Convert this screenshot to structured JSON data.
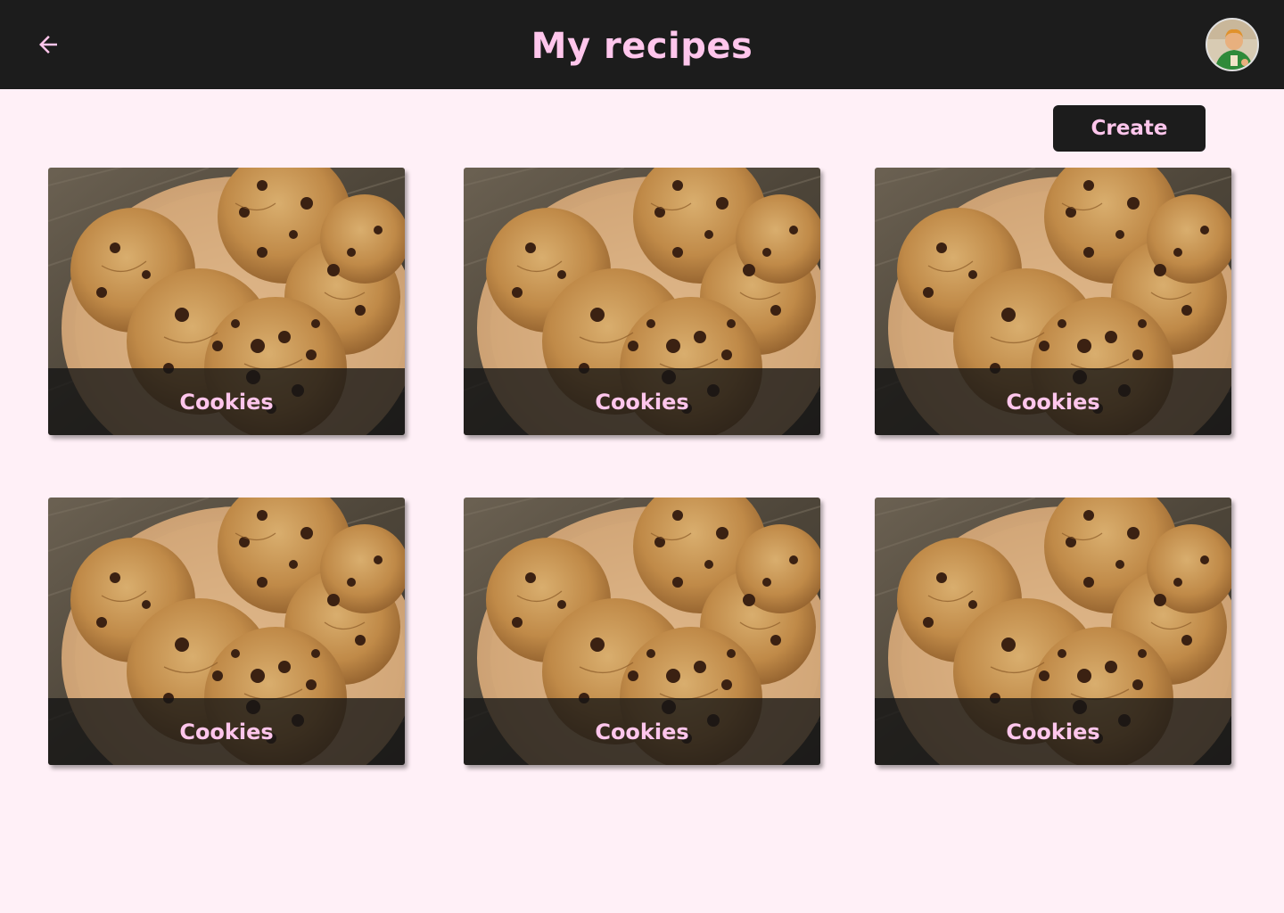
{
  "header": {
    "title": "My recipes",
    "back_icon": "arrow-left-icon",
    "avatar_icon": "user-avatar"
  },
  "toolbar": {
    "create_label": "Create"
  },
  "colors": {
    "header_bg": "#1c1c1c",
    "page_bg": "#fff0f7",
    "accent_pink": "#ffc6ec"
  },
  "recipes": [
    {
      "title": "Cookies"
    },
    {
      "title": "Cookies"
    },
    {
      "title": "Cookies"
    },
    {
      "title": "Cookies"
    },
    {
      "title": "Cookies"
    },
    {
      "title": "Cookies"
    }
  ]
}
